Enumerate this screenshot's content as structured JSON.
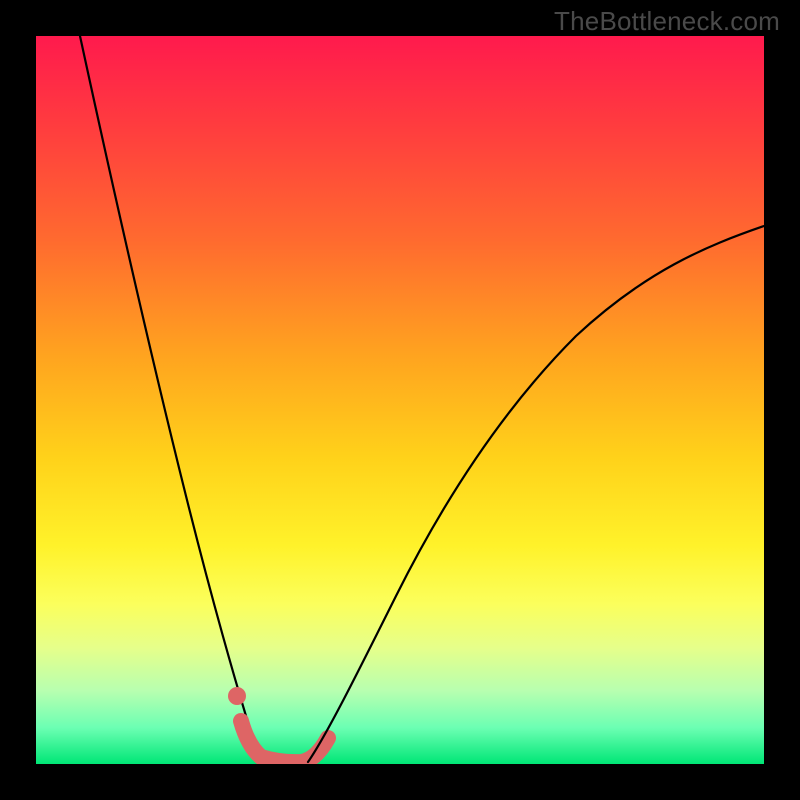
{
  "watermark": "TheBottleneck.com",
  "colors": {
    "background": "#000000",
    "curve": "#000000",
    "highlight": "#de6565",
    "gradient_top": "#ff1a4d",
    "gradient_bottom": "#00e676"
  },
  "chart_data": {
    "type": "line",
    "title": "",
    "xlabel": "",
    "ylabel": "",
    "xlim": [
      0,
      100
    ],
    "ylim": [
      0,
      100
    ],
    "axes_visible": false,
    "legend": false,
    "background": "vertical gradient red→yellow→green (top=high bottleneck, bottom=low)",
    "series": [
      {
        "name": "left-curve",
        "x": [
          6,
          8,
          10,
          12,
          14,
          16,
          18,
          20,
          22,
          24,
          26,
          28,
          29,
          30
        ],
        "values": [
          100,
          90,
          80,
          70,
          60,
          50,
          41,
          32,
          24,
          16,
          9,
          4,
          2,
          0
        ]
      },
      {
        "name": "right-curve",
        "x": [
          37,
          40,
          44,
          48,
          52,
          56,
          60,
          66,
          72,
          80,
          88,
          96,
          100
        ],
        "values": [
          0,
          6,
          14,
          22,
          29,
          35,
          41,
          48,
          54,
          61,
          67,
          72,
          74
        ]
      },
      {
        "name": "valley-floor",
        "x": [
          30,
          32,
          34,
          36,
          37
        ],
        "values": [
          0,
          0,
          0,
          0,
          0
        ]
      }
    ],
    "highlight_band": {
      "description": "thick light-red segment tracing the valley minimum",
      "x": [
        27,
        29,
        31,
        33,
        35,
        37,
        39
      ],
      "values": [
        4,
        1,
        0,
        0,
        0,
        1,
        4
      ]
    },
    "highlight_dot": {
      "x": 27,
      "y": 9
    }
  }
}
